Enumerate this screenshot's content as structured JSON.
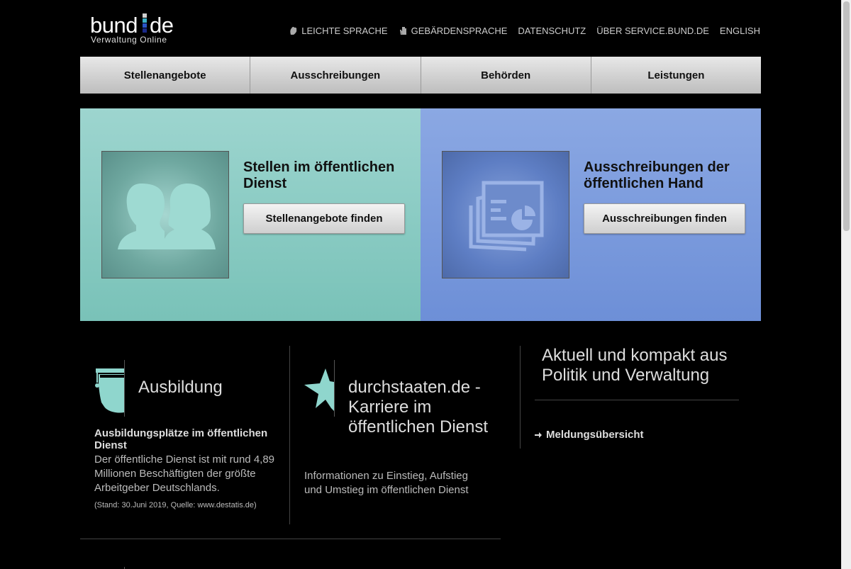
{
  "logo": {
    "word": "bund",
    "de": "de",
    "sub": "Verwaltung Online"
  },
  "topnav": [
    {
      "label": "LEICHTE SPRACHE",
      "icon": "easy-language-icon"
    },
    {
      "label": "GEBÄRDENSPRACHE",
      "icon": "sign-language-hand-icon"
    },
    {
      "label": "DATENSCHUTZ"
    },
    {
      "label": "ÜBER SERVICE.BUND.DE"
    },
    {
      "label": "ENGLISH"
    }
  ],
  "mainnav": [
    "Stellenangebote",
    "Ausschreibungen",
    "Behörden",
    "Leistungen"
  ],
  "hero": {
    "left": {
      "title": "Stellen im öffentlichen Dienst",
      "button": "Stellenangebote finden",
      "icon": "people-icon"
    },
    "right": {
      "title": "Ausschreibungen der öffentlichen Hand",
      "button": "Ausschreibungen finden",
      "icon": "presentation-chart-icon"
    }
  },
  "ausbildung": {
    "heading": "Ausbildung",
    "bold": "Ausbildungsplätze im öffentlichen Dienst",
    "text": "Der öffentliche Dienst ist mit rund 4,89 Millionen Beschäftigten der größte Arbeitgeber Deutschlands.",
    "small": "(Stand: 30.Juni 2019, Quelle: www.destatis.de)",
    "icon": "graduation-cap-icon"
  },
  "karriere": {
    "heading": "durchstaaten.de - Karriere im öffentlichen Dienst",
    "text": "Informationen zu Einstieg, Aufstieg und Umstieg im öffentlichen Dienst",
    "icon": "star-icon"
  },
  "aktuell": {
    "heading": "Aktuell und kompakt aus Politik und Verwaltung",
    "link": "Meldungsübersicht"
  },
  "colors": {
    "teal": "#8fcfc8",
    "blue": "#7d9cdf",
    "background": "#000000"
  }
}
